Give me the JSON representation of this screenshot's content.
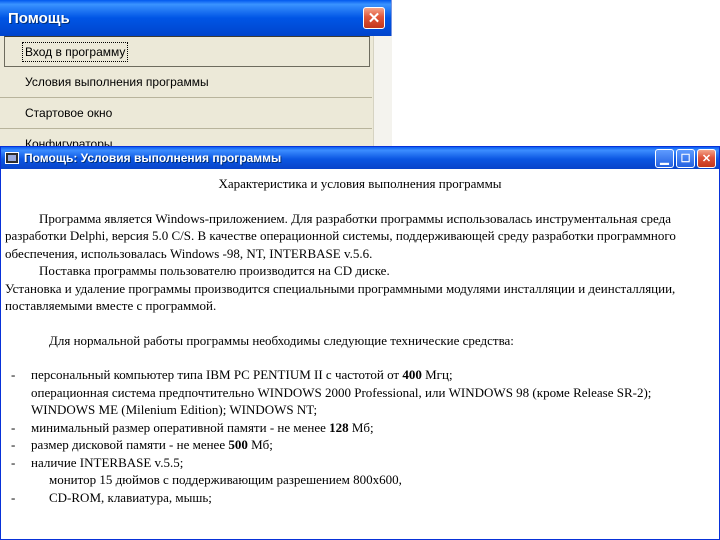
{
  "help_window": {
    "title": "Помощь",
    "items": [
      "Вход в программу",
      "Условия выполнения программы",
      "Стартовое окно",
      "Конфигураторы"
    ],
    "selected_index": 0
  },
  "doc_window": {
    "title": "Помощь: Условия выполнения программы",
    "heading": "Характеристика и условия выполнения программы",
    "paragraph1": "Программа является Windows-приложением. Для разработки программы использовалась инструментальная среда разработки Delphi, версия 5.0 C/S. В качестве операционной системы, поддерживающей среду разработки программного обеспечения, использовалась Windows -98, NT, INTERBASE v.5.6.",
    "paragraph2": "Поставка программы пользователю производится на CD диске.",
    "paragraph3": "Установка и удаление программы производится специальными программными модулями инсталляции и деинсталляции, поставляемыми вместе с программой.",
    "requirements_heading": "Для нормальной работы программы необходимы следующие технические средства:",
    "req1_a": "персональный компьютер типа IBM PC PENTIUM II с частотой от ",
    "req1_b": "400",
    "req1_c": " Мгц;",
    "req1_line2": "операционная система предпочтительно WINDOWS 2000 Professional, или WINDOWS 98 (кроме Release SR-2);",
    "req1_line3": "WINDOWS ME (Milenium Edition); WINDOWS NT;",
    "req2_a": "минимальный размер оперативной памяти - не менее ",
    "req2_b": "128",
    "req2_c": " Мб;",
    "req3_a": "размер дисковой памяти - не менее ",
    "req3_b": "500",
    "req3_c": "  Мб;",
    "req4": "наличие INTERBASE v.5.5;",
    "req4_line2": "монитор 15 дюймов с поддерживающим разрешением 800х600,",
    "req5": "CD-ROM, клавиатура, мышь;",
    "dash": "-"
  }
}
